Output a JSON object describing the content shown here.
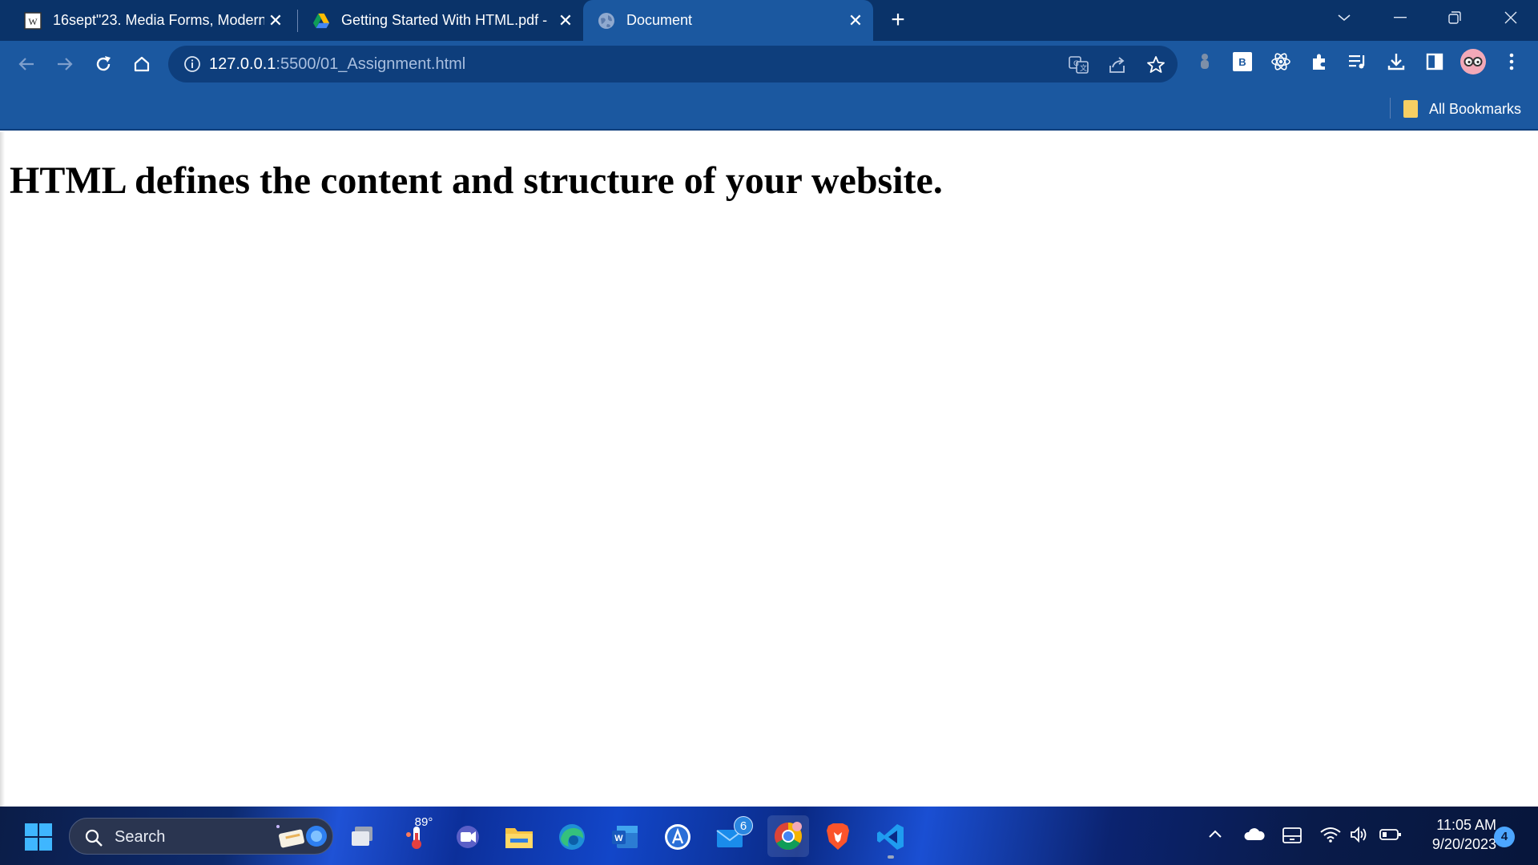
{
  "tabs": [
    {
      "title": "16sept\"23. Media Forms, Modern",
      "close": "✕"
    },
    {
      "title": "Getting Started With HTML.pdf -",
      "close": "✕"
    },
    {
      "title": "Document",
      "close": "✕"
    }
  ],
  "new_tab_label": "+",
  "address_bar": {
    "host": "127.0.0.1",
    "path": ":5500/01_Assignment.html"
  },
  "extension_b_label": "B",
  "bookmarks": {
    "all_label": "All Bookmarks"
  },
  "page": {
    "heading": "HTML defines the content and structure of your website."
  },
  "taskbar": {
    "search_label": "Search",
    "weather_temp": "89°",
    "mail_badge": "6",
    "time": "11:05 AM",
    "date": "9/20/2023",
    "notification_count": "4"
  },
  "colors": {
    "tabstrip": "#0a3369",
    "toolbar": "#1b58a0",
    "omnibox": "#0e3e7c"
  }
}
